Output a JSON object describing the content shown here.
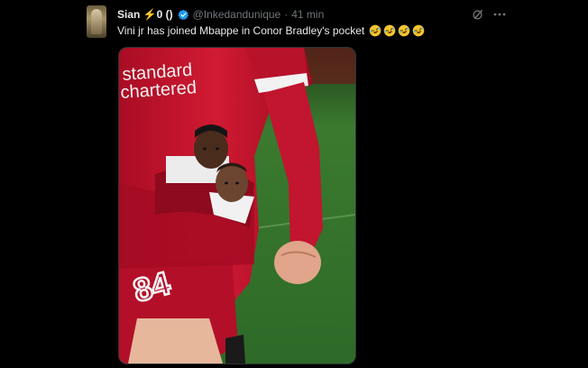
{
  "post": {
    "display_name": "Sian ⚡0 ()",
    "handle": "@Inkedandunique",
    "separator": "·",
    "time": "41 min",
    "text": "Vini jr has joined Mbappe in Conor Bradley's pocket",
    "emoji_count": 4
  },
  "media": {
    "shirt_sponsor_line1": "standard",
    "shirt_sponsor_line2": "chartered",
    "shorts_number": "84"
  },
  "colors": {
    "background": "#000000",
    "text_primary": "#e7e9ea",
    "text_secondary": "#71767b",
    "verified": "#1d9bf0",
    "kit_red": "#c8102e"
  },
  "icons": {
    "verified": "verified-badge-icon",
    "grok": "grok-icon",
    "more": "more-options-icon",
    "emoji": "rolling-on-floor-laughing-emoji"
  }
}
